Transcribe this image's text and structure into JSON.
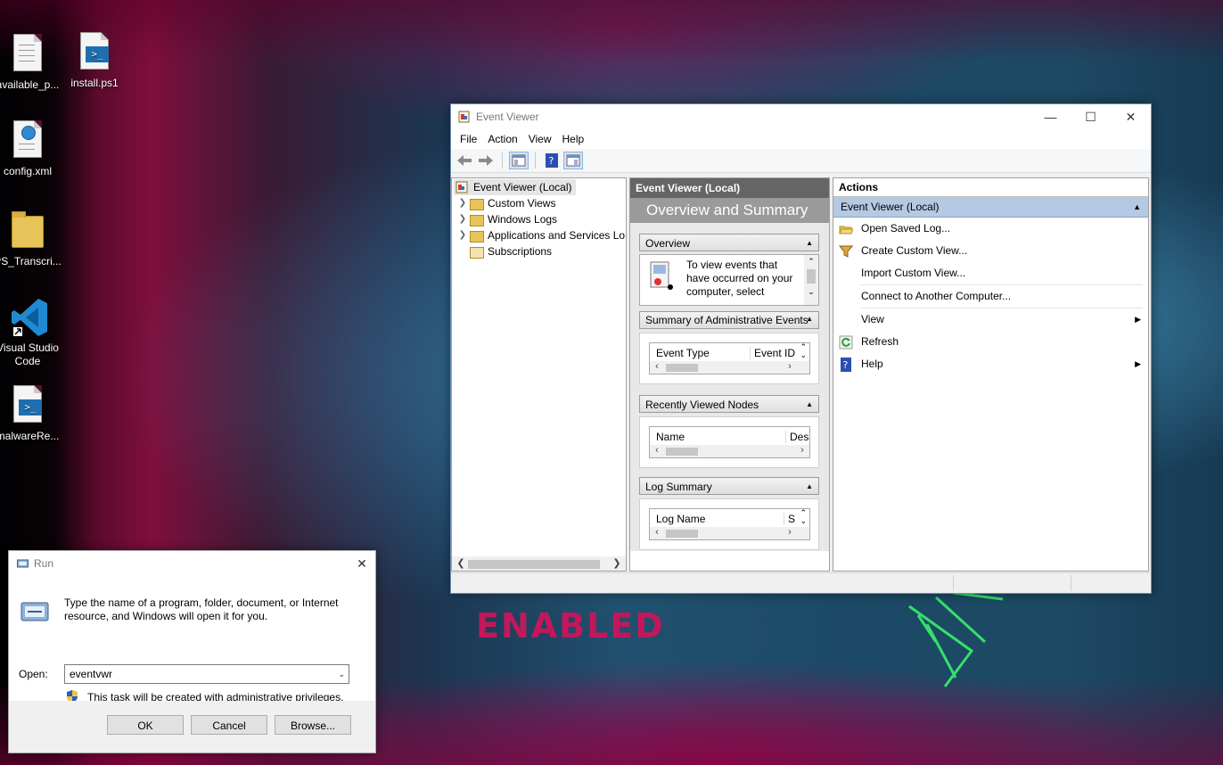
{
  "desktop": {
    "icons": [
      {
        "label": "available_p...",
        "icon": "text-file-icon"
      },
      {
        "label": "install.ps1",
        "icon": "powershell-file-icon"
      },
      {
        "label": "config.xml",
        "icon": "xml-file-icon"
      },
      {
        "label": "PS_Transcri...",
        "icon": "folder-icon"
      },
      {
        "label": "Visual Studio Code",
        "icon": "vscode-icon"
      },
      {
        "label": "malwareRe...",
        "icon": "powershell-file-icon"
      }
    ],
    "overlay_text": "ENABLED",
    "accent": "#c2185b"
  },
  "event_viewer": {
    "title": "Event Viewer",
    "window_controls": {
      "minimize": "—",
      "maximize": "☐",
      "close": "✕"
    },
    "menu": [
      "File",
      "Action",
      "View",
      "Help"
    ],
    "tree": {
      "root": "Event Viewer (Local)",
      "items": [
        "Custom Views",
        "Windows Logs",
        "Applications and Services Lo",
        "Subscriptions"
      ]
    },
    "middle": {
      "header": "Event Viewer (Local)",
      "band": "Overview and Summary",
      "sections": {
        "overview": {
          "title": "Overview",
          "text": "To view events that have occurred on your computer, select"
        },
        "admin": {
          "title": "Summary of Administrative Events",
          "col1": "Event Type",
          "col2": "Event ID"
        },
        "recent": {
          "title": "Recently Viewed Nodes",
          "col1": "Name",
          "col2": "Desc"
        },
        "log": {
          "title": "Log Summary",
          "col1": "Log Name",
          "col2": "S"
        }
      }
    },
    "actions": {
      "header": "Actions",
      "group": "Event Viewer (Local)",
      "items": [
        {
          "label": "Open Saved Log...",
          "icon": "open-folder-icon"
        },
        {
          "label": "Create Custom View...",
          "icon": "filter-icon"
        },
        {
          "label": "Import Custom View...",
          "icon": ""
        },
        {
          "label": "Connect to Another Computer...",
          "icon": ""
        },
        {
          "label": "View",
          "icon": "",
          "submenu": true
        },
        {
          "label": "Refresh",
          "icon": "refresh-icon"
        },
        {
          "label": "Help",
          "icon": "help-icon",
          "submenu": true
        }
      ]
    }
  },
  "run_dialog": {
    "title": "Run",
    "description": "Type the name of a program, folder, document, or Internet resource, and Windows will open it for you.",
    "open_label": "Open:",
    "open_value": "eventvwr",
    "admin_note": "This task will be created with administrative privileges.",
    "buttons": {
      "ok": "OK",
      "cancel": "Cancel",
      "browse": "Browse..."
    }
  }
}
